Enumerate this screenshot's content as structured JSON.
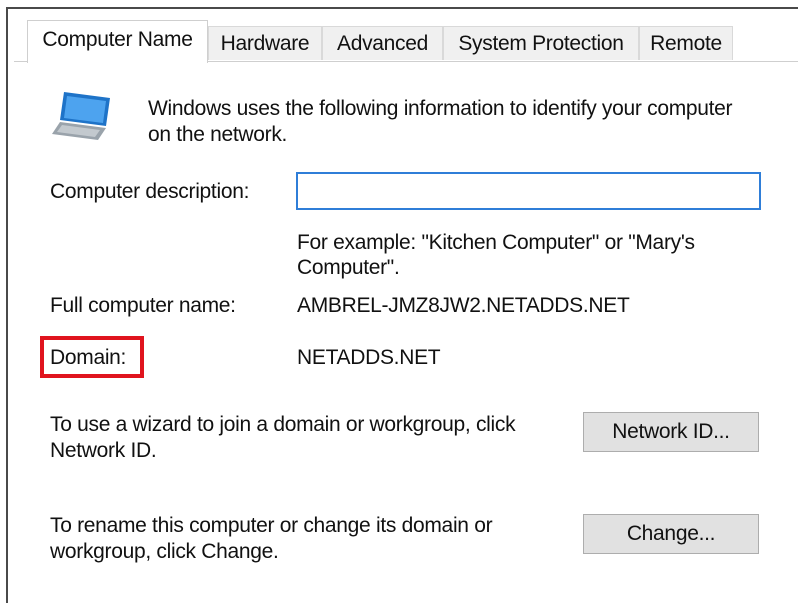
{
  "tabs": [
    {
      "label": "Computer Name",
      "active": true
    },
    {
      "label": "Hardware",
      "active": false
    },
    {
      "label": "Advanced",
      "active": false
    },
    {
      "label": "System Protection",
      "active": false
    },
    {
      "label": "Remote",
      "active": false
    }
  ],
  "intro": {
    "icon": "computer-network-icon",
    "line1": "Windows uses the following information to identify your computer",
    "line2": "on the network."
  },
  "description": {
    "label": "Computer description:",
    "value": "",
    "example_line1": "For example: \"Kitchen Computer\" or \"Mary's",
    "example_line2": "Computer\"."
  },
  "full_name": {
    "label": "Full computer name:",
    "value": "AMBREL-JMZ8JW2.NETADDS.NET"
  },
  "domain": {
    "label": "Domain:",
    "value": "NETADDS.NET"
  },
  "network_id": {
    "text_line1": "To use a wizard to join a domain or workgroup, click",
    "text_line2": "Network ID.",
    "button_label": "Network ID..."
  },
  "change": {
    "text_line1": "To rename this computer or change its domain or",
    "text_line2": "workgroup, click Change.",
    "button_label": "Change..."
  },
  "colors": {
    "highlight_border": "#e0141e",
    "input_border": "#2f7ed8"
  }
}
